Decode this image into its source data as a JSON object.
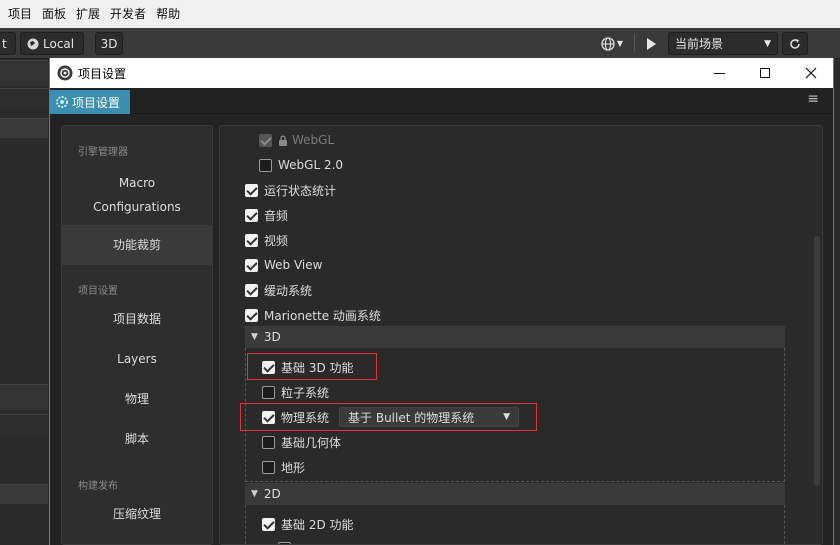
{
  "menubar": {
    "items": [
      "项目",
      "面板",
      "扩展",
      "开发者",
      "帮助"
    ]
  },
  "toolbar": {
    "partial_left_label": "t",
    "local_label": "Local",
    "mode_3d_label": "3D",
    "globe_icon": "globe-icon",
    "play_icon": "play-icon",
    "scene_select_value": "当前场景",
    "refresh_icon": "refresh-icon"
  },
  "dialog": {
    "title": "项目设置",
    "tab_label": "项目设置",
    "accent_color": "#3a8fb0"
  },
  "sidebar": {
    "group_engine": "引擎管理器",
    "macro_line1": "Macro",
    "macro_line2": "Configurations",
    "feature_crop": "功能裁剪",
    "group_project": "项目设置",
    "project_data": "项目数据",
    "layers": "Layers",
    "physics": "物理",
    "scripts": "脚本",
    "group_build": "构建发布",
    "texture_compression": "压缩纹理"
  },
  "content": {
    "webgl": {
      "label": "WebGL",
      "checked": true,
      "disabled": true
    },
    "webgl2": {
      "label": "WebGL 2.0",
      "checked": false
    },
    "profiler": {
      "label": "运行状态统计",
      "checked": true
    },
    "audio": {
      "label": "音频",
      "checked": true
    },
    "video": {
      "label": "视频",
      "checked": true
    },
    "webview": {
      "label": "Web View",
      "checked": true
    },
    "tween": {
      "label": "缓动系统",
      "checked": true
    },
    "marionette": {
      "label": "Marionette 动画系统",
      "checked": true
    },
    "section_3d": "3D",
    "base_3d": {
      "label": "基础 3D 功能",
      "checked": true
    },
    "particle": {
      "label": "粒子系统",
      "checked": false
    },
    "physics": {
      "label": "物理系统",
      "checked": true,
      "select_value": "基于 Bullet 的物理系统"
    },
    "primitives": {
      "label": "基础几何体",
      "checked": false
    },
    "terrain": {
      "label": "地形",
      "checked": false
    },
    "section_2d": "2D",
    "base_2d": {
      "label": "基础 2D 功能",
      "checked": true
    }
  },
  "highlight_color": "#e0353a"
}
